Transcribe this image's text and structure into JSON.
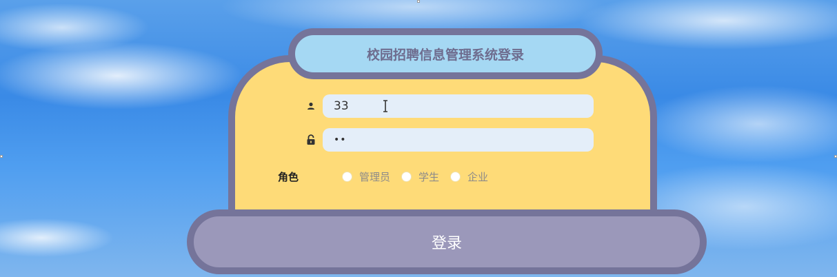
{
  "header": {
    "title": "校园招聘信息管理系统登录"
  },
  "form": {
    "username": {
      "value": "33",
      "icon": "user-icon"
    },
    "password": {
      "value": "••",
      "icon": "lock-icon"
    },
    "role": {
      "label": "角色",
      "options": [
        {
          "label": "管理员",
          "selected": false
        },
        {
          "label": "学生",
          "selected": false
        },
        {
          "label": "企业",
          "selected": false
        }
      ]
    }
  },
  "actions": {
    "login_label": "登录"
  },
  "colors": {
    "card_fill": "#fedb78",
    "border": "#75749a",
    "title_fill": "#a5d8f3",
    "button_fill": "#9b98ba",
    "input_fill": "#e4eef9"
  }
}
